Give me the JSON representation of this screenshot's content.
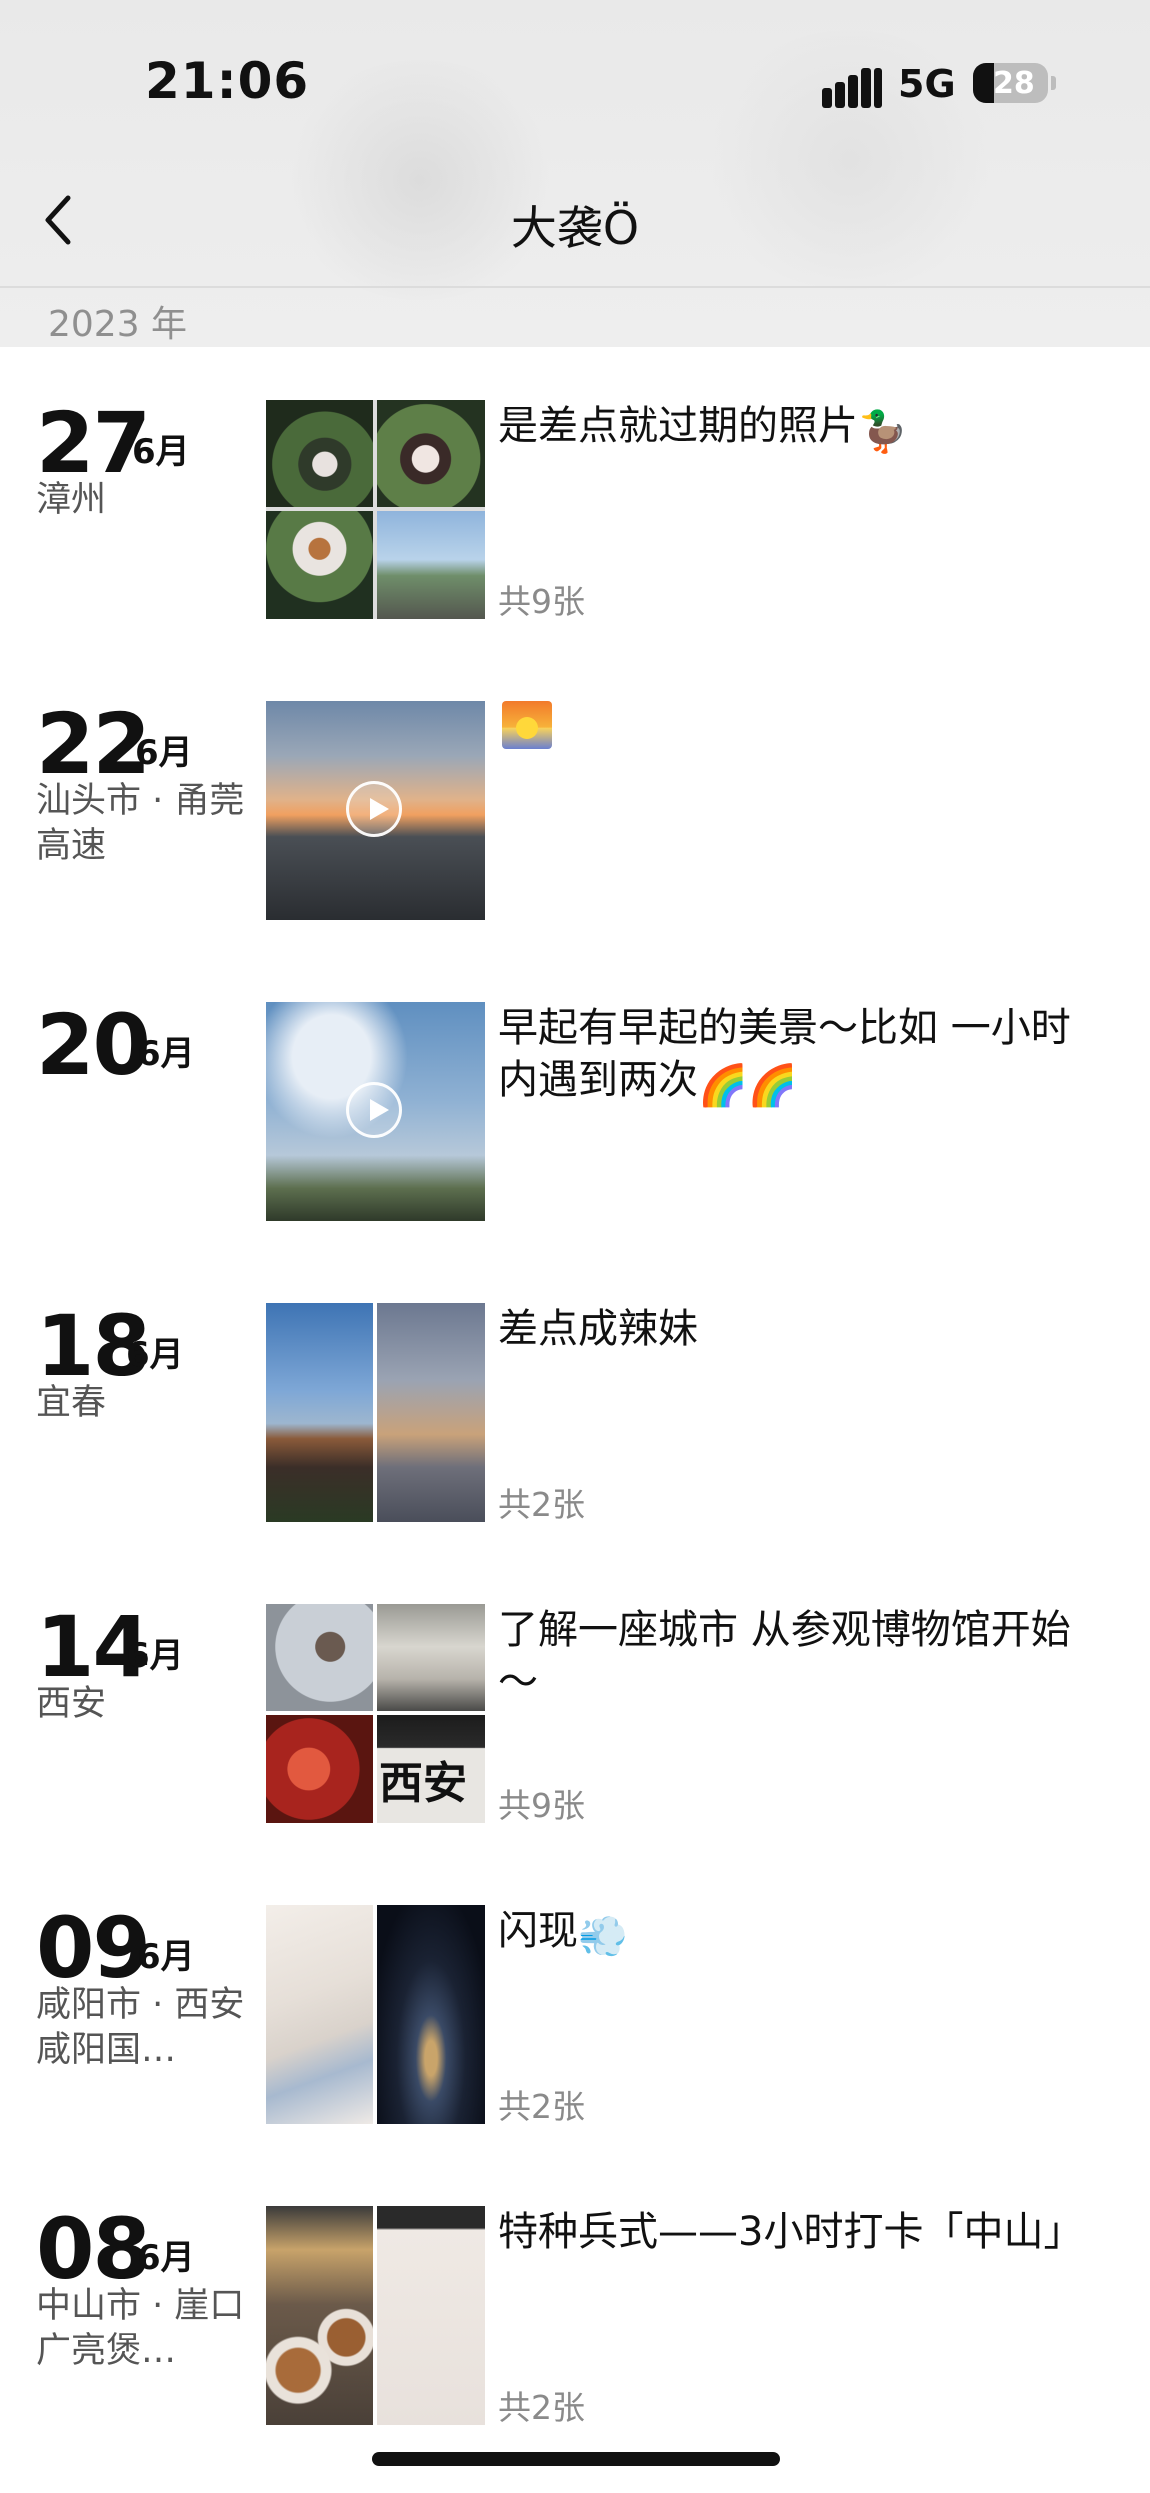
{
  "status_bar": {
    "time": "21:06",
    "network": "5G",
    "battery": "28",
    "battery_level": 0.28
  },
  "nav": {
    "title": "大袭Ö"
  },
  "year": "2023 年",
  "entries": [
    {
      "day": "27",
      "month": "6月",
      "location": "漳州",
      "caption": "是差点就过期的照片",
      "caption_emoji": "🦆",
      "count": "共9张",
      "media": "grid4"
    },
    {
      "day": "22",
      "month": "6月",
      "location": "汕头市 · 甬莞高速",
      "caption": "",
      "caption_emoji": "sunset",
      "count": "",
      "media": "video"
    },
    {
      "day": "20",
      "month": "6月",
      "location": "",
      "caption": "早起有早起的美景～比如 一小时内遇到两次",
      "caption_emoji": "🌈🌈",
      "count": "",
      "media": "video"
    },
    {
      "day": "18",
      "month": "6月",
      "location": "宜春",
      "caption": "差点成辣妹",
      "caption_emoji": "",
      "count": "共2张",
      "media": "pair"
    },
    {
      "day": "14",
      "month": "6月",
      "location": "西安",
      "caption": "了解一座城市 从参观博物馆开始～",
      "caption_emoji": "",
      "count": "共9张",
      "media": "grid4"
    },
    {
      "day": "09",
      "month": "6月",
      "location": "咸阳市 · 西安咸阳国…",
      "caption": "闪现",
      "caption_emoji": "💨",
      "count": "共2张",
      "media": "pair"
    },
    {
      "day": "08",
      "month": "6月",
      "location": "中山市 · 崖口广亮煲…",
      "caption": "特种兵式——3小时打卡「中山」",
      "caption_emoji": "",
      "count": "共2张",
      "media": "pair"
    }
  ]
}
